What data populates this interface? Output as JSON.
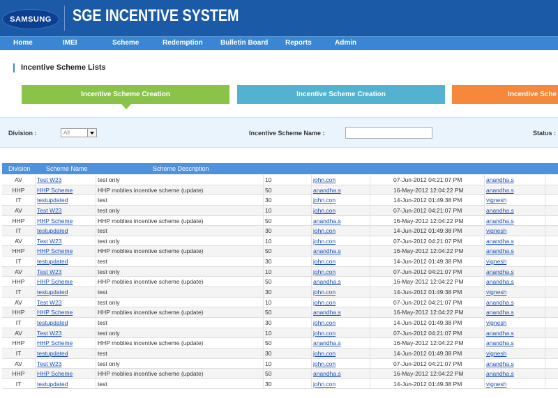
{
  "header": {
    "logo_text": "SAMSUNG",
    "app_title": "SGE INCENTIVE SYSTEM"
  },
  "nav": [
    "Home",
    "IMEI",
    "Scheme",
    "Redemption",
    "Bulletin Board",
    "Reports",
    "Admin"
  ],
  "page_title": "Incentive Scheme Lists",
  "tabs": [
    "Incentive Scheme Creation",
    "Incentive Scheme Creation",
    "Incentive Sche"
  ],
  "filters": {
    "division_label": "Division :",
    "division_value": "All",
    "scheme_name_label": "Incentive Scheme Name :",
    "scheme_name_value": "",
    "status_label": "Status :"
  },
  "table": {
    "headers": [
      "Division",
      "Scheme Name",
      "Scheme Description"
    ],
    "rows": [
      [
        "AV",
        "Test W23",
        "test only",
        "10",
        "john.con",
        "07-Jun-2012 04:21:07 PM",
        "anandha.s"
      ],
      [
        "HHP",
        "HHP Scheme",
        "HHP moblies incentive scheme (update)",
        "50",
        "anandha.s",
        "16-May-2012 12:04:22 PM",
        "anandha.s"
      ],
      [
        "IT",
        "testupdated",
        "test",
        "30",
        "john.con",
        "14-Jun-2012 01:49:38 PM",
        "vignesh"
      ],
      [
        "AV",
        "Test W23",
        "test only",
        "10",
        "john.con",
        "07-Jun-2012 04:21:07 PM",
        "anandha.s"
      ],
      [
        "HHP",
        "HHP Scheme",
        "HHP moblies incentive scheme (update)",
        "50",
        "anandha.s",
        "16-May-2012 12:04:22 PM",
        "anandha.s"
      ],
      [
        "IT",
        "testupdated",
        "test",
        "30",
        "john.con",
        "14-Jun-2012 01:49:38 PM",
        "vignesh"
      ],
      [
        "AV",
        "Test W23",
        "test only",
        "10",
        "john.con",
        "07-Jun-2012 04:21:07 PM",
        "anandha.s"
      ],
      [
        "HHP",
        "HHP Scheme",
        "HHP moblies incentive scheme (update)",
        "50",
        "anandha.s",
        "16-May-2012 12:04:22 PM",
        "anandha.s"
      ],
      [
        "IT",
        "testupdated",
        "test",
        "30",
        "john.con",
        "14-Jun-2012 01:49:38 PM",
        "vignesh"
      ],
      [
        "AV",
        "Test W23",
        "test only",
        "10",
        "john.con",
        "07-Jun-2012 04:21:07 PM",
        "anandha.s"
      ],
      [
        "HHP",
        "HHP Scheme",
        "HHP moblies incentive scheme (update)",
        "50",
        "anandha.s",
        "16-May-2012 12:04:22 PM",
        "anandha.s"
      ],
      [
        "IT",
        "testupdated",
        "test",
        "30",
        "john.con",
        "14-Jun-2012 01:49:38 PM",
        "vignesh"
      ],
      [
        "AV",
        "Test W23",
        "test only",
        "10",
        "john.con",
        "07-Jun-2012 04:21:07 PM",
        "anandha.s"
      ],
      [
        "HHP",
        "HHP Scheme",
        "HHP moblies incentive scheme (update)",
        "50",
        "anandha.s",
        "16-May-2012 12:04:22 PM",
        "anandha.s"
      ],
      [
        "IT",
        "testupdated",
        "test",
        "30",
        "john.con",
        "14-Jun-2012 01:49:38 PM",
        "vignesh"
      ],
      [
        "AV",
        "Test W23",
        "test only",
        "10",
        "john.con",
        "07-Jun-2012 04:21:07 PM",
        "anandha.s"
      ],
      [
        "HHP",
        "HHP Scheme",
        "HHP moblies incentive scheme (update)",
        "50",
        "anandha.s",
        "16-May-2012 12:04:22 PM",
        "anandha.s"
      ],
      [
        "IT",
        "testupdated",
        "test",
        "30",
        "john.con",
        "14-Jun-2012 01:49:38 PM",
        "vignesh"
      ],
      [
        "AV",
        "Test W23",
        "test only",
        "10",
        "john.con",
        "07-Jun-2012 04:21:07 PM",
        "anandha.s"
      ],
      [
        "HHP",
        "HHP Scheme",
        "HHP moblies incentive scheme (update)",
        "50",
        "anandha.s",
        "16-May-2012 12:04:22 PM",
        "anandha.s"
      ],
      [
        "IT",
        "testupdated",
        "test",
        "30",
        "john.con",
        "14-Jun-2012 01:49:38 PM",
        "vignesh"
      ]
    ]
  },
  "colors": {
    "header_bg": "#1b5aa6",
    "nav_bg": "#3a86d4",
    "tab_green": "#8bc34a",
    "tab_blue": "#52b2cf",
    "tab_orange": "#f5883a",
    "table_header_bg": "#4e91dd",
    "link": "#1a4fb5"
  }
}
